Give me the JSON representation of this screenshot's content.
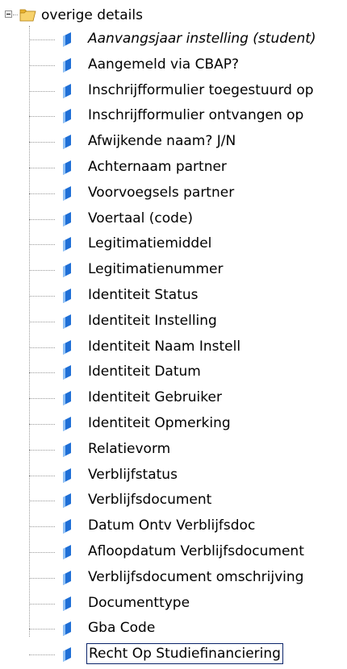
{
  "tree": {
    "root": {
      "label": "overige details",
      "icon": "open-folder-icon",
      "expanded": true
    },
    "items": [
      {
        "label": "Aanvangsjaar instelling (student)",
        "icon": "field-icon",
        "italic": true
      },
      {
        "label": "Aangemeld via CBAP?",
        "icon": "field-icon"
      },
      {
        "label": "Inschrijfformulier toegestuurd op",
        "icon": "field-icon"
      },
      {
        "label": "Inschrijfformulier ontvangen op",
        "icon": "field-icon"
      },
      {
        "label": "Afwijkende naam? J/N",
        "icon": "field-icon"
      },
      {
        "label": "Achternaam partner",
        "icon": "field-icon"
      },
      {
        "label": "Voorvoegsels partner",
        "icon": "field-icon"
      },
      {
        "label": "Voertaal (code)",
        "icon": "field-icon"
      },
      {
        "label": "Legitimatiemiddel",
        "icon": "field-icon"
      },
      {
        "label": "Legitimatienummer",
        "icon": "field-icon"
      },
      {
        "label": "Identiteit Status",
        "icon": "field-icon"
      },
      {
        "label": "Identiteit Instelling",
        "icon": "field-icon"
      },
      {
        "label": "Identiteit Naam Instell",
        "icon": "field-icon"
      },
      {
        "label": "Identiteit Datum",
        "icon": "field-icon"
      },
      {
        "label": "Identiteit Gebruiker",
        "icon": "field-icon"
      },
      {
        "label": "Identiteit Opmerking",
        "icon": "field-icon"
      },
      {
        "label": "Relatievorm",
        "icon": "field-icon"
      },
      {
        "label": "Verblijfstatus",
        "icon": "field-icon"
      },
      {
        "label": "Verblijfsdocument",
        "icon": "field-icon"
      },
      {
        "label": "Datum Ontv Verblijfsdoc",
        "icon": "field-icon"
      },
      {
        "label": "Afloopdatum Verblijfsdocument",
        "icon": "field-icon"
      },
      {
        "label": "Verblijfsdocument omschrijving",
        "icon": "field-icon"
      },
      {
        "label": "Documenttype",
        "icon": "field-icon"
      },
      {
        "label": "Gba Code",
        "icon": "field-icon"
      },
      {
        "label": "Recht Op Studiefinanciering",
        "icon": "field-icon",
        "selected": true
      }
    ]
  },
  "colors": {
    "icon_blue": "#1f6fd6",
    "icon_light": "#8fc0f5",
    "folder_yellow": "#f4c542",
    "selection_border": "#0a246a"
  }
}
